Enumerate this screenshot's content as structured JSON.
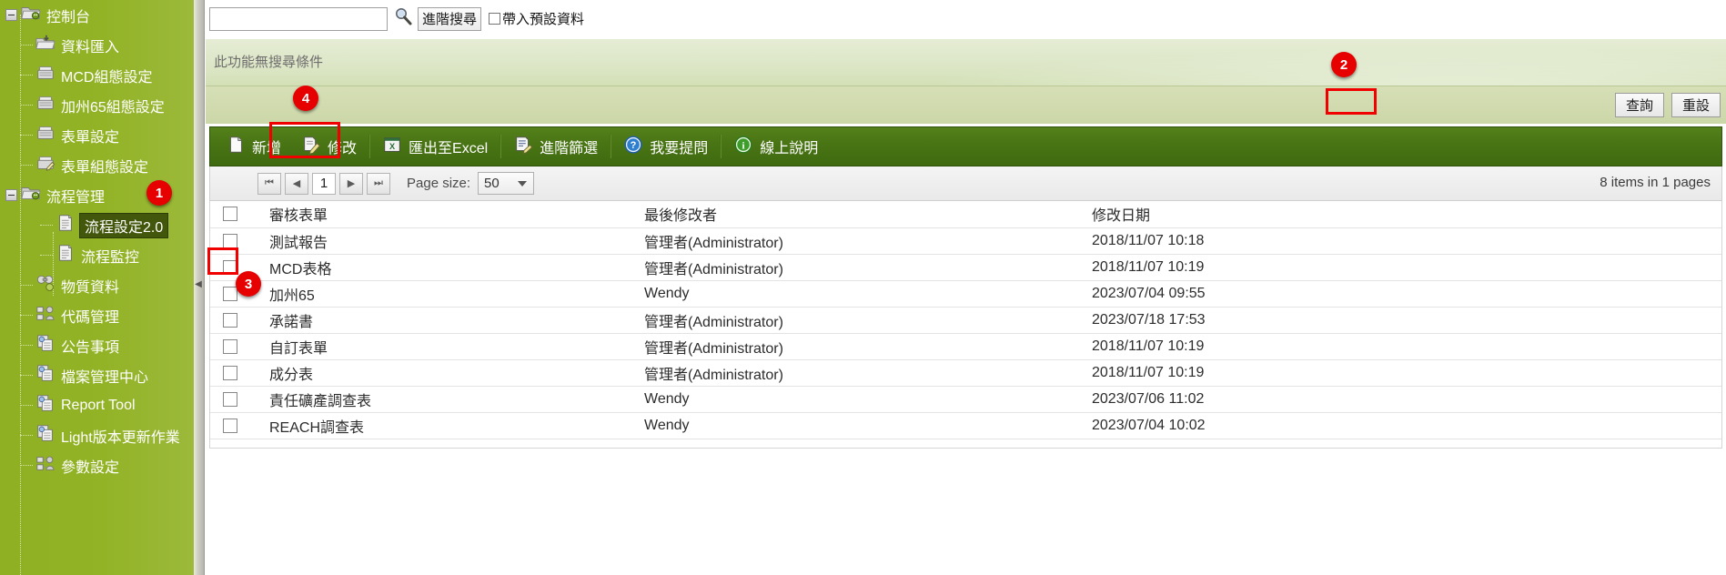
{
  "sidebar": {
    "items": [
      {
        "label": "控制台",
        "icon": "folder-gear-icon",
        "depth": 0,
        "expander": true,
        "selected": false
      },
      {
        "label": "資料匯入",
        "icon": "import-folder-icon",
        "depth": 1,
        "expander": false,
        "selected": false
      },
      {
        "label": "MCD組態設定",
        "icon": "config-icon",
        "depth": 1,
        "expander": false,
        "selected": false
      },
      {
        "label": "加州65組態設定",
        "icon": "config-icon",
        "depth": 1,
        "expander": false,
        "selected": false
      },
      {
        "label": "表單設定",
        "icon": "config-icon",
        "depth": 1,
        "expander": false,
        "selected": false
      },
      {
        "label": "表單組態設定",
        "icon": "config-edit-icon",
        "depth": 1,
        "expander": false,
        "selected": false
      },
      {
        "label": "流程管理",
        "icon": "folder-gear-icon",
        "depth": 0,
        "expander": true,
        "selected": false
      },
      {
        "label": "流程設定2.0",
        "icon": "document-icon",
        "depth": 2,
        "expander": false,
        "selected": true
      },
      {
        "label": "流程監控",
        "icon": "document-icon",
        "depth": 2,
        "expander": false,
        "selected": false
      },
      {
        "label": "物質資料",
        "icon": "molecule-icon",
        "depth": 1,
        "expander": false,
        "selected": false
      },
      {
        "label": "代碼管理",
        "icon": "code-icon",
        "depth": 1,
        "expander": false,
        "selected": false
      },
      {
        "label": "公告事項",
        "icon": "pages-icon",
        "depth": 1,
        "expander": false,
        "selected": false
      },
      {
        "label": "檔案管理中心",
        "icon": "pages-icon",
        "depth": 1,
        "expander": false,
        "selected": false
      },
      {
        "label": "Report Tool",
        "icon": "pages-icon",
        "depth": 1,
        "expander": false,
        "selected": false
      },
      {
        "label": "Light版本更新作業",
        "icon": "pages-icon",
        "depth": 1,
        "expander": false,
        "selected": false
      },
      {
        "label": "參數設定",
        "icon": "code-icon",
        "depth": 1,
        "expander": false,
        "selected": false
      }
    ]
  },
  "search": {
    "input_value": "",
    "input_placeholder": "",
    "magnifier_icon": "search-icon",
    "advanced_button": "進階搜尋",
    "preset_checkbox_label": "帶入預設資料",
    "preset_checked": false
  },
  "condition_panel": {
    "text": "此功能無搜尋條件"
  },
  "action_buttons": {
    "query": "查詢",
    "reset": "重設"
  },
  "toolbar": {
    "items": [
      {
        "label": "新增",
        "icon": "new-page-icon"
      },
      {
        "label": "修改",
        "icon": "edit-page-icon"
      },
      {
        "label": "匯出至Excel",
        "icon": "excel-icon"
      },
      {
        "label": "進階篩選",
        "icon": "filter-icon"
      },
      {
        "label": "我要提問",
        "icon": "question-mark-icon"
      },
      {
        "label": "線上說明",
        "icon": "info-icon"
      }
    ]
  },
  "pager": {
    "first_icon": "first-page-icon",
    "prev_icon": "prev-page-icon",
    "current_page": "1",
    "next_icon": "next-page-icon",
    "last_icon": "last-page-icon",
    "page_size_label": "Page size:",
    "page_size_value": "50",
    "items_count": "8 items in 1 pages"
  },
  "table": {
    "headers": [
      "審核表單",
      "最後修改者",
      "修改日期"
    ],
    "rows": [
      {
        "name": "測試報告",
        "user": "管理者(Administrator)",
        "date": "2018/11/07 10:18",
        "checked": false
      },
      {
        "name": "MCD表格",
        "user": "管理者(Administrator)",
        "date": "2018/11/07 10:19",
        "checked": false
      },
      {
        "name": "加州65",
        "user": "Wendy",
        "date": "2023/07/04 09:55",
        "checked": false
      },
      {
        "name": "承諾書",
        "user": "管理者(Administrator)",
        "date": "2023/07/18 17:53",
        "checked": false
      },
      {
        "name": "自訂表單",
        "user": "管理者(Administrator)",
        "date": "2018/11/07 10:19",
        "checked": false
      },
      {
        "name": "成分表",
        "user": "管理者(Administrator)",
        "date": "2018/11/07 10:19",
        "checked": false
      },
      {
        "name": "責任礦產調查表",
        "user": "Wendy",
        "date": "2023/07/06 11:02",
        "checked": false
      },
      {
        "name": "REACH調查表",
        "user": "Wendy",
        "date": "2023/07/04 10:02",
        "checked": false
      }
    ]
  },
  "annotations": {
    "badges": [
      {
        "number": "1",
        "target": "sidebar-item-流程管理"
      },
      {
        "number": "2",
        "target": "query-button"
      },
      {
        "number": "3",
        "target": "row-checkbox-mcd"
      },
      {
        "number": "4",
        "target": "toolbar-edit"
      }
    ],
    "accent_color": "#e60000",
    "highlight_color": "#f10000"
  }
}
